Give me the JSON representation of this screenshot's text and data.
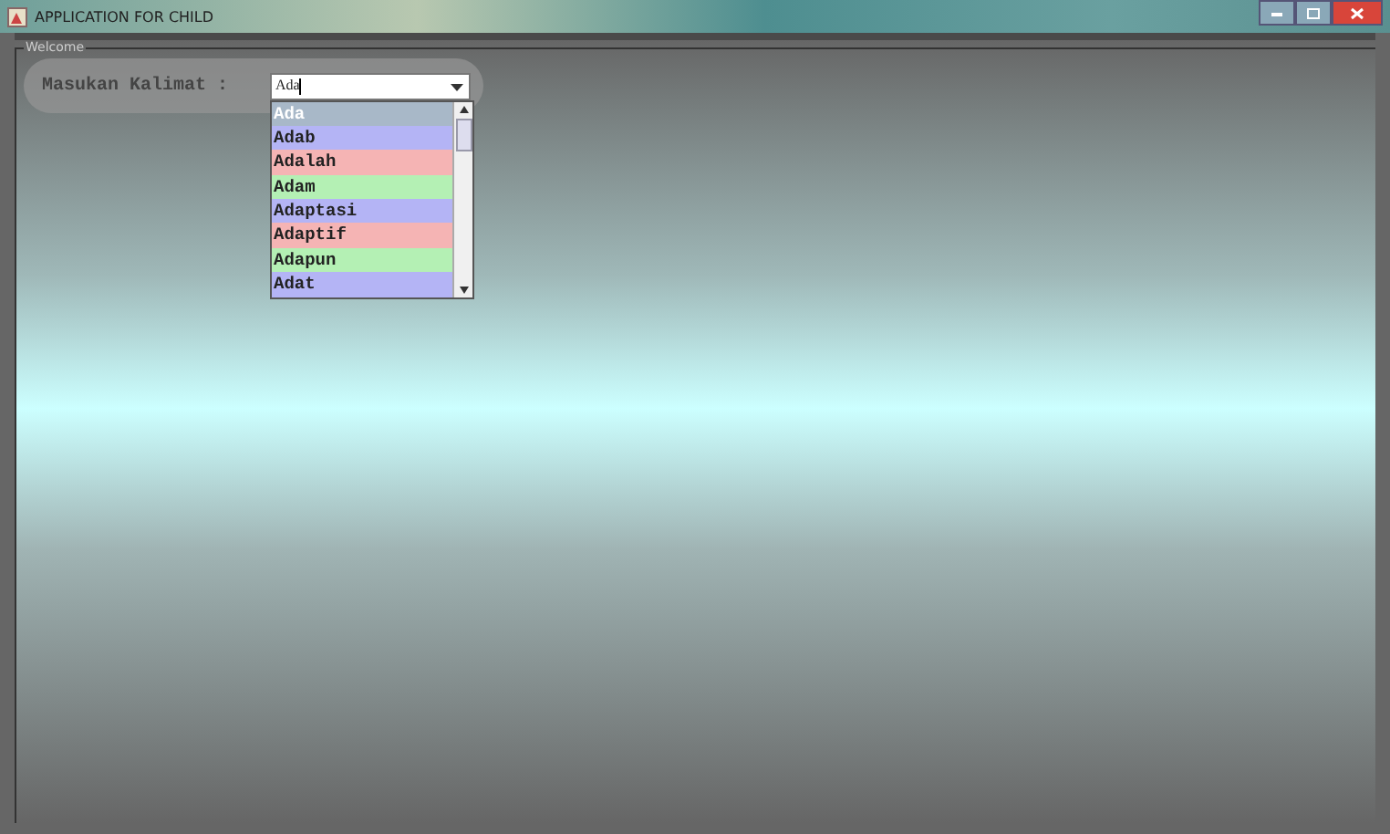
{
  "window": {
    "title": "APPLICATION FOR CHILD"
  },
  "group": {
    "title": "Welcome"
  },
  "form": {
    "label": "Masukan Kalimat :",
    "combo": {
      "value": "Ada",
      "expanded": true
    }
  },
  "suggestions": [
    {
      "text": "Ada",
      "selected": true,
      "color": "#a8b8c8"
    },
    {
      "text": "Adab",
      "selected": false,
      "color": "#b4b4f5"
    },
    {
      "text": "Adalah",
      "selected": false,
      "color": "#f5b4b4"
    },
    {
      "text": "Adam",
      "selected": false,
      "color": "#b4f0b4"
    },
    {
      "text": "Adaptasi",
      "selected": false,
      "color": "#b4b4f5"
    },
    {
      "text": "Adaptif",
      "selected": false,
      "color": "#f5b4b4"
    },
    {
      "text": "Adapun",
      "selected": false,
      "color": "#b4f0b4"
    },
    {
      "text": "Adat",
      "selected": false,
      "color": "#b4b4f5"
    }
  ]
}
